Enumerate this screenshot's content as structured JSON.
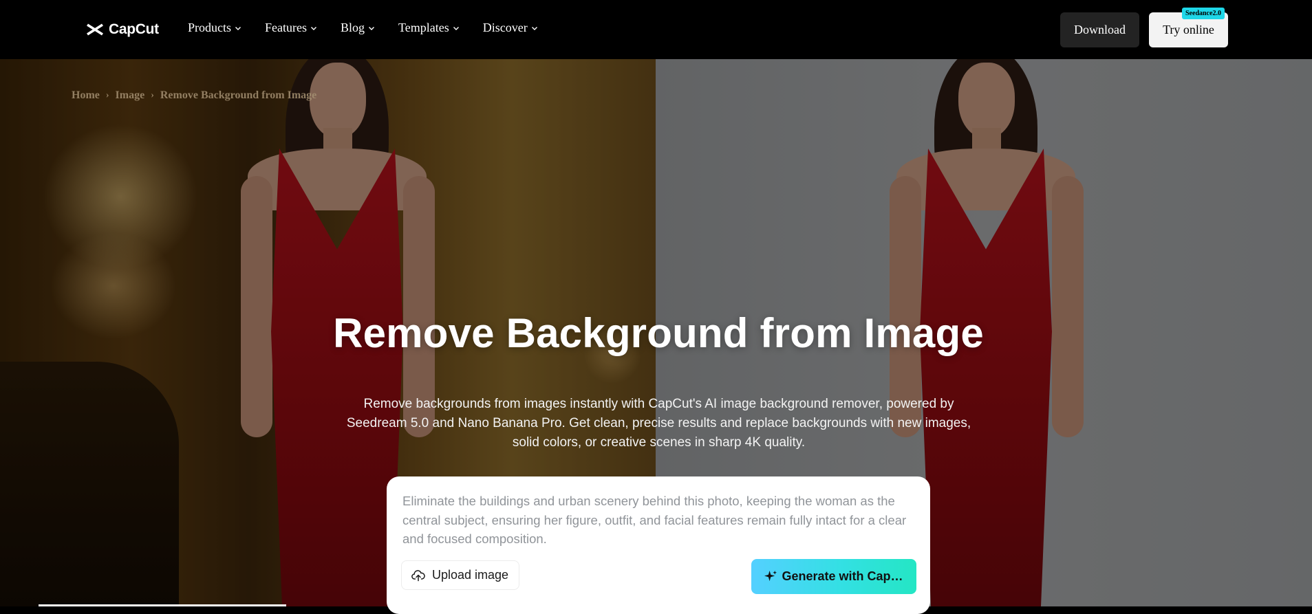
{
  "nav": {
    "logo_text": "CapCut",
    "items": [
      {
        "label": "Products"
      },
      {
        "label": "Features"
      },
      {
        "label": "Blog"
      },
      {
        "label": "Templates"
      },
      {
        "label": "Discover"
      }
    ],
    "download_label": "Download",
    "try_online_label": "Try online",
    "badge_label": "Seedance2.0"
  },
  "breadcrumb": {
    "items": [
      "Home",
      "Image",
      "Remove Background from Image"
    ]
  },
  "hero": {
    "title": "Remove Background from Image",
    "description": "Remove backgrounds from images instantly with CapCut's AI image background remover, powered by Seedream 5.0 and Nano Banana Pro. Get clean, precise results and replace backgrounds with new images, solid colors, or creative scenes in sharp 4K quality."
  },
  "prompt": {
    "value": "Eliminate the buildings and urban scenery behind this photo, keeping the woman as the central subject, ensuring her figure, outfit, and facial features remain fully intact for a clear and focused composition.",
    "upload_label": "Upload image",
    "generate_label": "Generate with Cap…"
  },
  "icons": {
    "logo": "capcut-logo-icon",
    "chevron": "chevron-down-icon",
    "upload": "cloud-upload-icon",
    "generate": "sparkle-icon",
    "breadcrumb_sep": "chevron-right-icon"
  },
  "colors": {
    "nav_bg": "#000000",
    "download_bg": "#232323",
    "try_bg": "#f3f3f3",
    "badge_bg": "#1ed7e8",
    "generate_gradient_start": "#54d0ff",
    "generate_gradient_end": "#24e6c4",
    "dress": "#b0121a"
  }
}
